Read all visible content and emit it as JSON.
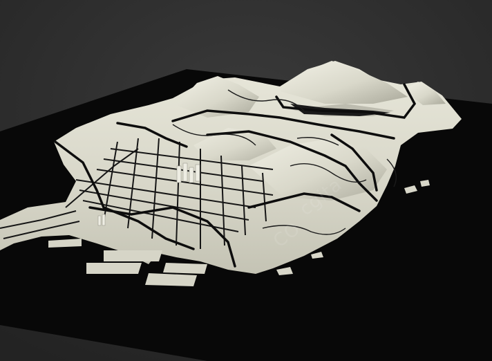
{
  "render": {
    "subject": "3d-terrain-map-model",
    "colors": {
      "background": "#2b2b2b",
      "base_plate": "#080808",
      "terrain": "#dcdbcd",
      "terrain_shadow": "#b9b8aa",
      "roads": "#111111"
    }
  },
  "watermarks": [
    {
      "id": "wm1",
      "text": "cgita"
    },
    {
      "id": "wm2",
      "text": "CO"
    }
  ]
}
